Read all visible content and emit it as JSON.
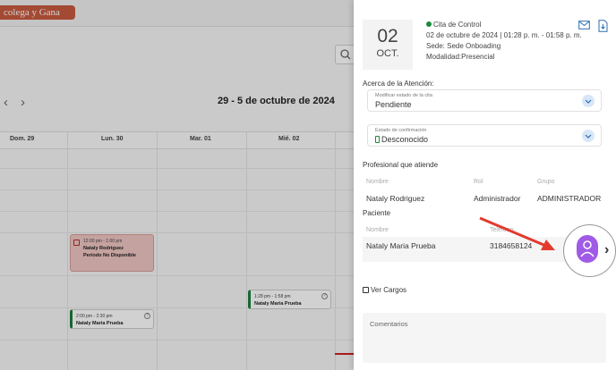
{
  "calendar": {
    "promo_label": "colega y Gana",
    "range_title": "29 - 5 de octubre de 2024",
    "days": [
      "Dom. 29",
      "Lun. 30",
      "Mar. 01",
      "Mié. 02"
    ],
    "events": [
      {
        "time": "12:00 pm - 1:00 pm",
        "name": "Nataly Rodriguez",
        "extra": "Período No Disponible"
      },
      {
        "time": "1:28 pm - 1:58 pm",
        "name": "Nataly Maria Prueba"
      },
      {
        "time": "2:00 pm - 2:30 pm",
        "name": "Nataly Maria Prueba"
      }
    ]
  },
  "panel": {
    "date_day": "02",
    "date_month": "OCT.",
    "appointment_title": "Cita de Control",
    "appointment_datetime": "02 de octubre de 2024 | 01:28 p. m. - 01:58 p. m.",
    "appointment_site": "Sede: Sede Onboading",
    "appointment_mode": "Modalidad:Presencial",
    "about_title": "Acerca de la Atención:",
    "status_field": {
      "label": "Modificar estado de la cita",
      "value": "Pendiente"
    },
    "confirmation_field": {
      "label": "Estado de confirmación",
      "value": "Desconocido"
    },
    "professional_title": "Profesional que atiende",
    "professional_columns": [
      "Nombre",
      "Rol",
      "Grupo"
    ],
    "professional_row": [
      "Nataly Rodriguez",
      "Administrador",
      "ADMINISTRADOR"
    ],
    "patient_title": "Paciente",
    "patient_columns": [
      "Nombre",
      "Teléfono"
    ],
    "patient_row": [
      "Nataly Maria Prueba",
      "3184658124"
    ],
    "charges_link": "Ver Cargos",
    "comments_placeholder": "Comentarios"
  },
  "colors": {
    "status_dot": "#1b8a3a",
    "avatar_button": "#a05be6",
    "annotation_arrow": "#e23b2e",
    "accent_blue": "#2b6cb0"
  },
  "icons": [
    "mail-icon",
    "document-download-icon",
    "search-icon",
    "chevron-down-icon",
    "edit-icon",
    "avatar-icon",
    "chevron-right-icon"
  ]
}
